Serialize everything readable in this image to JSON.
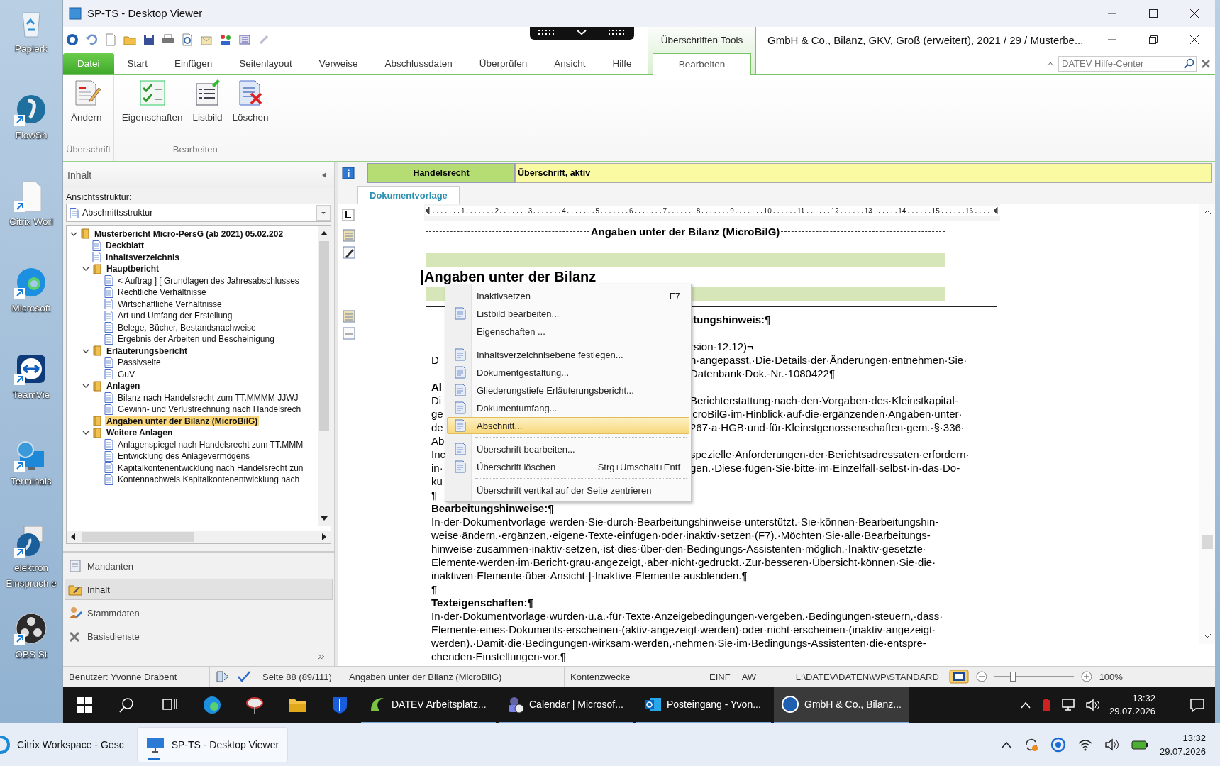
{
  "desktop_icons": [
    {
      "lines": [
        "Papierk"
      ]
    },
    {
      "lines": [
        "FlowSh"
      ]
    },
    {
      "lines": [
        "Citrix Worl"
      ]
    },
    {
      "lines": [
        "Microsoft"
      ]
    },
    {
      "lines": [
        "TeamVie"
      ]
    },
    {
      "lines": [
        "Terminals"
      ]
    },
    {
      "lines": [
        "elektron",
        "Einspruch e"
      ]
    },
    {
      "lines": [
        "OBS St"
      ]
    }
  ],
  "window": {
    "title": "SP-TS - Desktop Viewer"
  },
  "app": {
    "document_title": "GmbH & Co., Bilanz, GKV, Groß (erweitert), 2021 / 29 / Musterbe...",
    "contextual_group": "Überschriften Tools",
    "tabs": [
      {
        "label": "Datei",
        "kind": "file",
        "selected": false
      },
      {
        "label": "Start",
        "kind": "normal",
        "selected": false
      },
      {
        "label": "Einfügen",
        "kind": "normal",
        "selected": false
      },
      {
        "label": "Seitenlayout",
        "kind": "normal",
        "selected": false
      },
      {
        "label": "Verweise",
        "kind": "normal",
        "selected": false
      },
      {
        "label": "Abschlussdaten",
        "kind": "normal",
        "selected": false
      },
      {
        "label": "Überprüfen",
        "kind": "normal",
        "selected": false
      },
      {
        "label": "Ansicht",
        "kind": "normal",
        "selected": false
      },
      {
        "label": "Hilfe",
        "kind": "normal",
        "selected": false
      },
      {
        "label": "Bearbeiten",
        "kind": "contextual",
        "selected": true
      }
    ],
    "help_search": {
      "placeholder": "DATEV Hilfe-Center"
    },
    "ribbon_groups": [
      {
        "label": "Überschrift",
        "buttons": [
          {
            "label": "Ändern"
          }
        ]
      },
      {
        "label": "Bearbeiten",
        "buttons": [
          {
            "label": "Eigenschaften"
          },
          {
            "label": "Listbild"
          },
          {
            "label": "Löschen"
          }
        ]
      }
    ]
  },
  "sidebar": {
    "title": "Inhalt",
    "structure_label": "Ansichtsstruktur:",
    "structure_value": "Abschnittsstruktur",
    "tree": [
      {
        "label": "Musterbericht Micro-PersG (ab 2021) 05.02.202",
        "kind": "folder",
        "selected": false,
        "expanded": true,
        "children": [
          {
            "label": "Deckblatt",
            "kind": "page",
            "selected": false
          },
          {
            "label": "Inhaltsverzeichnis",
            "kind": "page",
            "selected": false
          },
          {
            "label": "Hauptbericht",
            "kind": "folder",
            "selected": false,
            "expanded": true,
            "children": [
              {
                "label": "< Auftrag ] [ Grundlagen des Jahresabschlusses",
                "kind": "page",
                "selected": false
              },
              {
                "label": "Rechtliche Verhältnisse",
                "kind": "page",
                "selected": false
              },
              {
                "label": "Wirtschaftliche Verhältnisse",
                "kind": "page",
                "selected": false
              },
              {
                "label": "Art und Umfang der Erstellung",
                "kind": "page",
                "selected": false
              },
              {
                "label": "Belege, Bücher, Bestandsnachweise",
                "kind": "page",
                "selected": false
              },
              {
                "label": "Ergebnis der Arbeiten und Bescheinigung",
                "kind": "page",
                "selected": false
              }
            ]
          },
          {
            "label": "Erläuterungsbericht",
            "kind": "folder",
            "selected": false,
            "expanded": true,
            "children": [
              {
                "label": "Passivseite",
                "kind": "page",
                "selected": false
              },
              {
                "label": "GuV",
                "kind": "page",
                "selected": false
              }
            ]
          },
          {
            "label": "Anlagen",
            "kind": "folder",
            "selected": false,
            "expanded": true,
            "children": [
              {
                "label": "Bilanz nach Handelsrecht zum TT.MMMM JJWJ",
                "kind": "page",
                "selected": false
              },
              {
                "label": "Gewinn- und Verlustrechnung nach Handelsrech",
                "kind": "page",
                "selected": false
              }
            ]
          },
          {
            "label": "Angaben unter der Bilanz (MicroBilG)",
            "kind": "folder",
            "selected": true
          },
          {
            "label": "Weitere Anlagen",
            "kind": "folder",
            "selected": false,
            "expanded": true,
            "children": [
              {
                "label": "Anlagenspiegel nach Handelsrecht zum TT.MMM",
                "kind": "page",
                "selected": false
              },
              {
                "label": "Entwicklung des Anlagevermögens",
                "kind": "page",
                "selected": false
              },
              {
                "label": "Kapitalkontenentwicklung nach Handelsrecht zun",
                "kind": "page",
                "selected": false
              },
              {
                "label": "Kontennachweis Kapitalkontenentwicklung nach",
                "kind": "page",
                "selected": false
              }
            ]
          }
        ]
      }
    ],
    "nav": [
      {
        "label": "Mandanten",
        "selected": false
      },
      {
        "label": "Inhalt",
        "selected": true
      },
      {
        "label": "Stammdaten",
        "selected": false
      },
      {
        "label": "Basisdienste",
        "selected": false
      }
    ]
  },
  "info_bar": {
    "category": "Handelsrecht",
    "status": "Überschrift, aktiv"
  },
  "doc_tab": "Dokumentvorlage",
  "ruler": [
    "1",
    "2",
    "3",
    "4",
    "5",
    "6",
    "7",
    "8",
    "9",
    "10",
    "11",
    "12",
    "13",
    "14",
    "15",
    "16"
  ],
  "document": {
    "header": "Angaben unter der Bilanz (MicroBilG)",
    "heading": "Angaben unter der Bilanz",
    "lines": [
      {
        "kind": "heading",
        "right": "itungshinweis:¶"
      },
      {
        "kind": "blank"
      },
      {
        "kind": "text",
        "right": "rsion·12.12)¬"
      },
      {
        "kind": "text",
        "left": "D",
        "right": "n·angepasst.·Die·Details·der·Änderungen·entnehmen·Sie·"
      },
      {
        "kind": "text",
        "right": "Datenbank·Dok.-Nr.·1080422¶"
      },
      {
        "kind": "heading",
        "left": "Al"
      },
      {
        "kind": "text",
        "left": "Di",
        "right": "Berichterstattung·nach·den·Vorgaben·des·Kleinstkapital-"
      },
      {
        "kind": "text",
        "left": "ge",
        "right": "icroBilG·im·Hinblick·auf·die·ergänzenden·Angaben·unter·"
      },
      {
        "kind": "text",
        "left": "de",
        "right": "267·a·HGB·und·für·Kleinstgenossenschaften·gem.·§·336·"
      },
      {
        "kind": "text",
        "left": "Ab"
      },
      {
        "kind": "text",
        "left": "Inc",
        "right": "spezielle·Anforderungen·der·Berichtsadressaten·erfordern·"
      },
      {
        "kind": "text",
        "left": "in·",
        "right": "gen.·Diese·fügen·Sie·bitte·im·Einzelfall·selbst·in·das·Do-"
      },
      {
        "kind": "text",
        "left": "ku"
      },
      {
        "kind": "text",
        "left": "¶"
      },
      {
        "kind": "heading",
        "left": "Bearbeitungshinweise:¶"
      },
      {
        "kind": "text",
        "left": "In·der·Dokumentvorlage·werden·Sie·durch·Bearbeitungshinweise·unterstützt.·Sie·können·Bearbeitungshin-"
      },
      {
        "kind": "text",
        "left": "weise·ändern,·ergänzen,·eigene·Texte·einfügen·oder·inaktiv·setzen·(F7).·Möchten·Sie·alle·Bearbeitungs-"
      },
      {
        "kind": "text",
        "left": "hinweise·zusammen·inaktiv·setzen,·ist·dies·über·den·Bedingungs-Assistenten·möglich.·Inaktiv·gesetzte·"
      },
      {
        "kind": "text",
        "left": "Elemente·werden·im·Bericht·grau·angezeigt,·aber·nicht·gedruckt.·Zur·besseren·Übersicht·können·Sie·die·"
      },
      {
        "kind": "text",
        "left": "inaktiven·Elemente·über·Ansicht·|·Inaktive·Elemente·ausblenden.¶"
      },
      {
        "kind": "text",
        "left": "¶"
      },
      {
        "kind": "heading",
        "left": "Texteigenschaften:¶"
      },
      {
        "kind": "text",
        "left": "In·der·Dokumentvorlage·wurden·u.a.·für·Texte·Anzeigebedingungen·vergeben.·Bedingungen·steuern,·dass·"
      },
      {
        "kind": "text",
        "left": "Elemente·eines·Dokuments·erscheinen·(aktiv·angezeigt·werden)·oder·nicht·erscheinen·(inaktiv·angezeigt·"
      },
      {
        "kind": "text",
        "left": "werden).·Damit·die·Bedingungen·wirksam·werden,·nehmen·Sie·im·Bedingungs-Assistenten·die·entspre-"
      },
      {
        "kind": "text",
        "left": "chenden·Einstellungen·vor.¶"
      }
    ]
  },
  "context_menu": [
    {
      "kind": "item",
      "label": "Inaktivsetzen",
      "shortcut": "F7",
      "icon": false,
      "selected": false
    },
    {
      "kind": "item",
      "label": "Listbild bearbeiten...",
      "icon": true,
      "selected": false
    },
    {
      "kind": "item",
      "label": "Eigenschaften ...",
      "icon": false,
      "selected": false
    },
    {
      "kind": "separator"
    },
    {
      "kind": "item",
      "label": "Inhaltsverzeichnisebene festlegen...",
      "icon": true,
      "selected": false
    },
    {
      "kind": "item",
      "label": "Dokumentgestaltung...",
      "icon": true,
      "selected": false
    },
    {
      "kind": "item",
      "label": "Gliederungstiefe Erläuterungsbericht...",
      "icon": true,
      "selected": false
    },
    {
      "kind": "item",
      "label": "Dokumentumfang...",
      "icon": true,
      "selected": false
    },
    {
      "kind": "item",
      "label": "Abschnitt...",
      "icon": true,
      "selected": true
    },
    {
      "kind": "separator"
    },
    {
      "kind": "item",
      "label": "Überschrift bearbeiten...",
      "icon": true,
      "selected": false
    },
    {
      "kind": "item",
      "label": "Überschrift löschen",
      "shortcut": "Strg+Umschalt+Entf",
      "icon": true,
      "selected": false
    },
    {
      "kind": "separator"
    },
    {
      "kind": "item",
      "label": "Überschrift vertikal auf der Seite zentrieren",
      "icon": false,
      "selected": false
    }
  ],
  "status_bar": {
    "user": "Benutzer: Yvonne Drabent",
    "page": "Seite 88 (89/111)",
    "section": "Angaben unter der Bilanz (MicroBilG)",
    "field": "Kontenzwecke",
    "mode": "EINF",
    "mode2": "AW",
    "path": "L:\\DATEV\\DATEN\\WP\\STANDARD",
    "zoom": {
      "level": 0.2,
      "reading": "100%"
    }
  },
  "inner_taskbar": {
    "apps": [
      {
        "label": "DATEV Arbeitsplatz...",
        "selected": false
      },
      {
        "label": "Calendar | Microsof...",
        "selected": false
      },
      {
        "label": "Posteingang - Yvon...",
        "selected": false
      },
      {
        "label": "GmbH & Co., Bilanz...",
        "selected": true
      }
    ],
    "time": "13:32",
    "date": "29.07.2026"
  },
  "taskbar": {
    "apps": [
      {
        "label": "Citrix Workspace - Gesc",
        "selected": false
      },
      {
        "label": "SP-TS - Desktop Viewer",
        "selected": true
      }
    ],
    "time": "13:32",
    "date": "29.07.2026"
  }
}
